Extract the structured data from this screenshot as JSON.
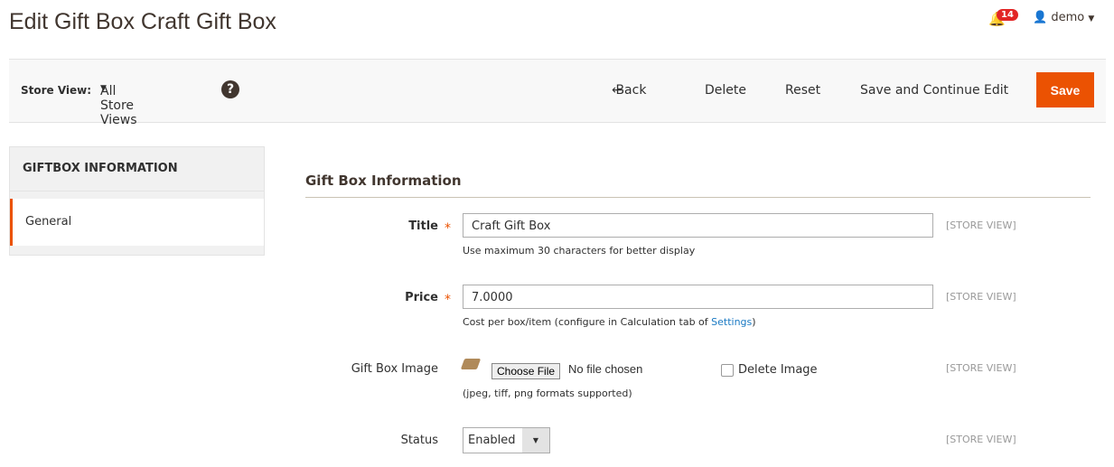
{
  "page_title": "Edit Gift Box Craft Gift Box",
  "header": {
    "notifications": "14",
    "user": "demo"
  },
  "toolbar": {
    "store_view_label": "Store View:",
    "store_view_value": "All Store Views",
    "back": "Back",
    "delete": "Delete",
    "reset": "Reset",
    "save_continue": "Save and Continue Edit",
    "save": "Save"
  },
  "sidebar": {
    "title": "GIFTBOX INFORMATION",
    "items": [
      {
        "label": "General"
      }
    ]
  },
  "form": {
    "section_title": "Gift Box Information",
    "scope": "[STORE VIEW]",
    "title": {
      "label": "Title",
      "value": "Craft Gift Box",
      "note": "Use maximum 30 characters for better display"
    },
    "price": {
      "label": "Price",
      "value": "7.0000",
      "note": "Cost per box/item (configure in Calculation tab of ",
      "note_link": "Settings",
      "note_end": ")"
    },
    "image": {
      "label": "Gift Box Image",
      "choose": "Choose File",
      "no_file": "No file chosen",
      "delete": "Delete Image",
      "note": "(jpeg, tiff, png formats supported)"
    },
    "status": {
      "label": "Status",
      "value": "Enabled"
    }
  },
  "colors": {
    "accent": "#eb5202",
    "badge": "#e22626"
  }
}
